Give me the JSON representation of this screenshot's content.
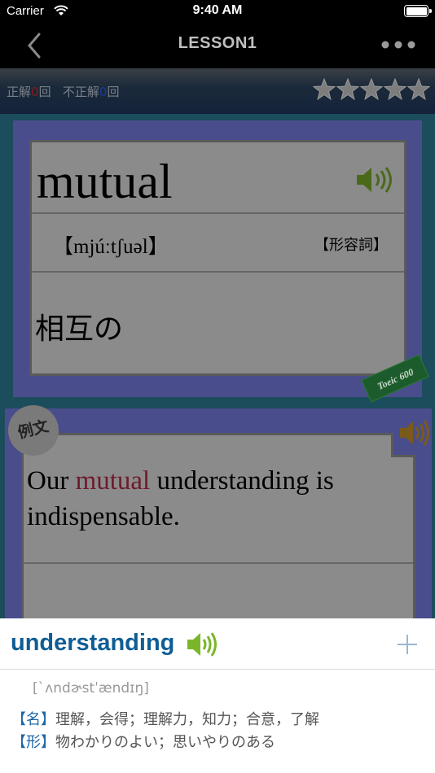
{
  "status": {
    "carrier": "Carrier",
    "time": "9:40 AM"
  },
  "nav": {
    "title": "LESSON1",
    "back_icon": "chevron-left-icon",
    "more_icon": "ellipsis-icon"
  },
  "score": {
    "correct_label": "正解",
    "correct_count": "0",
    "correct_unit": "回",
    "incorrect_label": "不正解",
    "incorrect_count": "0",
    "incorrect_unit": "回",
    "stars_filled": 0,
    "stars_total": 5
  },
  "card": {
    "word": "mutual",
    "pronunciation": "【mjúːtʃuəl】",
    "part_of_speech": "【形容詞】",
    "meaning": "相互の",
    "badge": "Toeic 600"
  },
  "example": {
    "badge": "例文",
    "before": "Our ",
    "highlight": "mutual",
    "after": " understanding is indispensable."
  },
  "popup": {
    "word": "understanding",
    "pronunciation": "[ˋʌndɚstˈændɪŋ]",
    "definitions": [
      {
        "tag": "【名】",
        "text": "理解，会得；理解力，知力；合意，了解"
      },
      {
        "tag": "【形】",
        "text": "物わかりのよい；思いやりのある"
      }
    ]
  },
  "colors": {
    "accent_blue": "#0f5d95",
    "speaker_green": "#7bb62a",
    "speaker_orange": "#f0a020"
  }
}
